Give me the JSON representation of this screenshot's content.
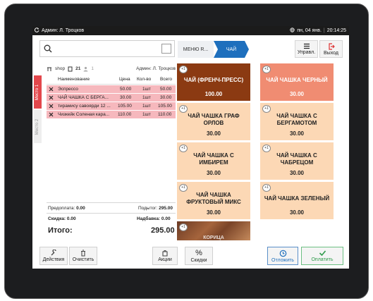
{
  "status_bar": {
    "user": "Админ: Л. Троцков",
    "date": "пн, 04 янв.",
    "time": "20:14:25"
  },
  "breadcrumb": [
    "МЕНЮ R...",
    "ЧАЙ"
  ],
  "top_buttons": {
    "manage": "Управл.",
    "exit": "Выход"
  },
  "side_tabs": [
    "Место 1",
    "Место 2"
  ],
  "order_info": {
    "shop": "shop",
    "table": "21",
    "guests": "1",
    "cashier": "Админ: Л. Троцков"
  },
  "table_headers": {
    "name": "Наименование",
    "price": "Цена",
    "qty": "Кол-во",
    "total": "Всего"
  },
  "order_items": [
    {
      "name": "Эспрессо",
      "price": "50.00",
      "qty": "1шт",
      "total": "50.00"
    },
    {
      "name": "ЧАЙ ЧАШКА С БЕРГА...",
      "price": "30.00",
      "qty": "1шт",
      "total": "30.00"
    },
    {
      "name": "тирамису савоярди 12 ...",
      "price": "105.00",
      "qty": "1шт",
      "total": "105.00"
    },
    {
      "name": "Чизкейк Соленая кара...",
      "price": "110.00",
      "qty": "1шт",
      "total": "110.00"
    }
  ],
  "summary": {
    "prepay_label": "Предоплата:",
    "prepay_value": "0.00",
    "subtotal_label": "Подытог:",
    "subtotal_value": "295.00",
    "discount_label": "Скидка:",
    "discount_value": "0.00",
    "markup_label": "Надбавка:",
    "markup_value": "0.00",
    "total_label": "Итого:",
    "total_value": "295.00"
  },
  "menu_items": [
    {
      "name": "ЧАЙ (ФРЕНЧ-ПРЕСС)",
      "price": "100.00",
      "badge": "+1",
      "color": "#8b3a12",
      "text_color": "#ffffff"
    },
    {
      "name": "ЧАЙ ЧАШКА ЧЕРНЫЙ",
      "price": "30.00",
      "badge": "+1",
      "color": "#f08c72",
      "text_color": "#ffffff"
    },
    {
      "name": "ЧАЙ ЧАШКА ГРАФ ОРЛОВ",
      "price": "30.00",
      "badge": "+1",
      "color": "#fcd8b5",
      "text_color": "#222222"
    },
    {
      "name": "ЧАЙ ЧАШКА С БЕРГАМОТОМ",
      "price": "30.00",
      "badge": "+1",
      "color": "#fcd8b5",
      "text_color": "#222222"
    },
    {
      "name": "ЧАЙ ЧАШКА С ИМБИРЕМ",
      "price": "30.00",
      "badge": "+1",
      "color": "#fcd8b5",
      "text_color": "#222222"
    },
    {
      "name": "ЧАЙ ЧАШКА С ЧАБРЕЦОМ",
      "price": "30.00",
      "badge": "+1",
      "color": "#fcd8b5",
      "text_color": "#222222"
    },
    {
      "name": "ЧАЙ ЧАШКА ФРУКТОВЫЙ МИКС",
      "price": "30.00",
      "badge": "+1",
      "color": "#fcd8b5",
      "text_color": "#222222"
    },
    {
      "name": "ЧАЙ ЧАШКА ЗЕЛЕНЫЙ",
      "price": "30.00",
      "badge": "+1",
      "color": "#fcd8b5",
      "text_color": "#222222"
    }
  ],
  "partial_tile": {
    "badge": "+1",
    "label": "КОРИЦА"
  },
  "bottom_buttons": {
    "actions": "Действия",
    "clear": "Очистить",
    "promos": "Акции",
    "discounts": "Скидки",
    "defer": "Отложить",
    "pay": "Оплатить"
  },
  "colors": {
    "accent": "#1e6fbd",
    "pay_green": "#2e9b4a",
    "selected_row": "#f6b8bd",
    "tab_red": "#e3474c"
  }
}
